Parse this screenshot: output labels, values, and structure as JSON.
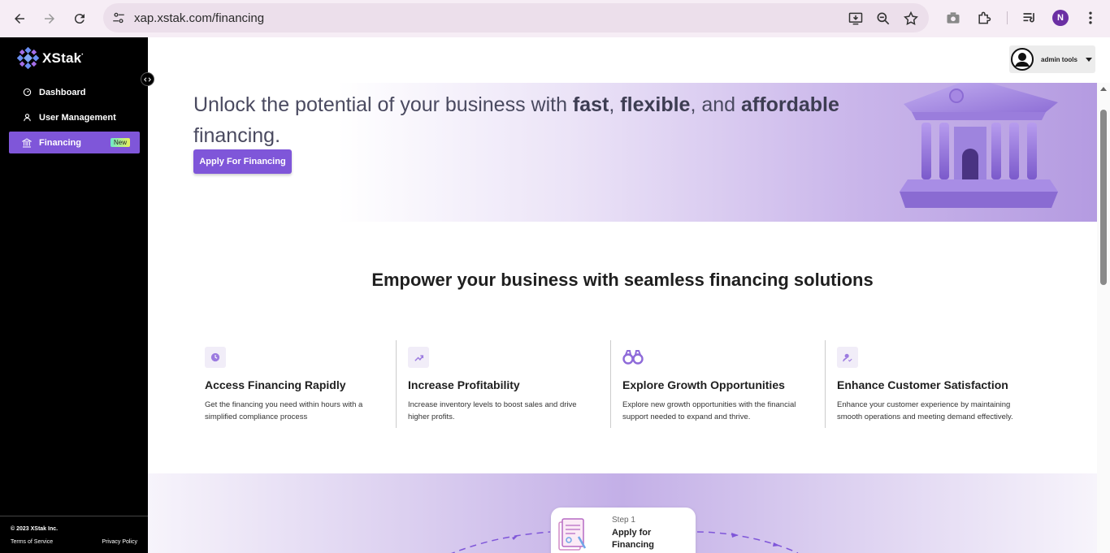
{
  "browser": {
    "url": "xap.xstak.com/financing",
    "profile_initial": "N"
  },
  "sidebar": {
    "logo_text": "XStak",
    "items": [
      {
        "label": "Dashboard",
        "icon": "dashboard-icon"
      },
      {
        "label": "User Management",
        "icon": "user-management-icon"
      },
      {
        "label": "Financing",
        "icon": "bank-icon",
        "badge": "New",
        "active": true
      }
    ],
    "footer": {
      "copyright": "© 2023 XStak Inc.",
      "terms": "Terms of Service",
      "privacy": "Privacy Policy"
    }
  },
  "topbar": {
    "user_label": "admin tools"
  },
  "hero": {
    "title_part1": "Unlock the potential of your business with ",
    "title_bold1": "fast",
    "title_part2": ", ",
    "title_bold2": "flexible",
    "title_part3": ", and ",
    "title_bold3": "affordable",
    "title_part4": " financing.",
    "apply_label": "Apply For Financing"
  },
  "section": {
    "title": "Empower your business with seamless financing solutions"
  },
  "features": [
    {
      "title": "Access Financing Rapidly",
      "desc": "Get the financing you need within hours with a simplified compliance process",
      "icon": "clock-icon"
    },
    {
      "title": "Increase Profitability",
      "desc": "Increase inventory levels to boost sales and drive higher profits.",
      "icon": "trend-up-icon"
    },
    {
      "title": "Explore Growth Opportunities",
      "desc": "Explore new growth opportunities with the financial support needed to expand and thrive.",
      "icon": "binoculars-icon"
    },
    {
      "title": "Enhance Customer Satisfaction",
      "desc": "Enhance your customer experience by maintaining smooth operations and meeting demand effectively.",
      "icon": "customer-satisfaction-icon"
    }
  ],
  "steps": [
    {
      "num": "Step 1",
      "title": "Apply for Financing"
    }
  ],
  "colors": {
    "accent": "#7f56d9",
    "sidebar_bg": "#000000"
  }
}
